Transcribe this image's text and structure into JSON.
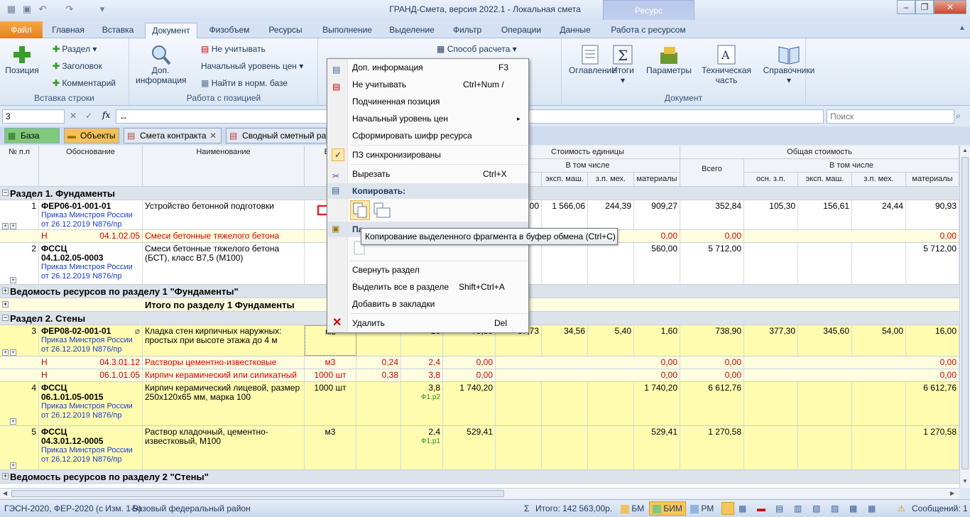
{
  "window": {
    "title": "ГРАНД-Смета, версия 2022.1 - Локальная смета",
    "context_tab": "Ресурс"
  },
  "tabs": [
    "Файл",
    "Главная",
    "Вставка",
    "Документ",
    "Физобъем",
    "Ресурсы",
    "Выполнение",
    "Выделение",
    "Фильтр",
    "Операции",
    "Данные",
    "Работа с ресурсом"
  ],
  "ribbon": {
    "insert_row": {
      "label": "Вставка строки",
      "position": "Позиция",
      "section": "Раздел",
      "heading": "Заголовок",
      "comment": "Комментарий"
    },
    "position_work": {
      "label": "Работа с позицией",
      "dop_info": "Доп. информация",
      "ignore": "Не учитывать",
      "price_level": "Начальный уровень цен",
      "find_norm": "Найти в норм. базе"
    },
    "calc_method": "Способ расчета",
    "document": {
      "label": "Документ",
      "toc": "Оглавление",
      "totals": "Итоги",
      "params": "Параметры",
      "tech": "Техническая часть",
      "refs": "Справочники"
    }
  },
  "formula": {
    "cell": "3",
    "value": "",
    "search_placeholder": "Поиск"
  },
  "doc_tabs": [
    "База",
    "Объекты",
    "Смета контракта",
    "Сводный сметный рас"
  ],
  "headers": {
    "num": "№ п.п",
    "basis": "Обоснование",
    "name": "Наименование",
    "unit": "Ед.",
    "unit_cost": "Стоимость единицы",
    "incl": "В том числе",
    "total_cost": "Общая стоимость",
    "all": "Всего",
    "incl2": "В том числе",
    "cols": [
      "осн. з.п.",
      "эксп. маш.",
      "з.п. мех.",
      "материалы"
    ]
  },
  "rows": [
    {
      "type": "section",
      "text": "Раздел 1. Фундаменты"
    },
    {
      "type": "item",
      "num": "1",
      "code": "ФЕР06-01-001-01",
      "order": "Приказ Минстроя России от 26.12.2019 N876/пр",
      "name": "Устройство бетонной подготовки",
      "unit": "",
      "c1": "",
      "c2": "",
      "c3": "",
      "c4": ",00",
      "c5": "1 566,06",
      "c6": "244,39",
      "c7": "909,27",
      "t1": "352,84",
      "t2": "105,30",
      "t3": "156,61",
      "t4": "24,44",
      "t5": "90,93"
    },
    {
      "type": "res",
      "mark": "Н",
      "code": "04.1.02.05",
      "name": "Смеси бетонные тяжелого бетона",
      "unit": "",
      "a": "",
      "b": "",
      "c": "",
      "m": "0,00",
      "t": "0,00",
      "tm": "0,00"
    },
    {
      "type": "item2",
      "num": "2",
      "code1": "ФССЦ",
      "code2": "04.1.02.05-0003",
      "order": "Приказ Минстроя России от 26.12.2019 N876/пр",
      "name": "Смеси бетонные тяжелого бетона (БСТ), класс В7,5 (М100)",
      "c7": "560,00",
      "t1": "5 712,00",
      "t5": "5 712,00"
    },
    {
      "type": "section",
      "text": "Ведомость ресурсов по разделу 1 \"Фундаменты\""
    },
    {
      "type": "total",
      "text": "Итого по разделу 1 Фундаменты"
    },
    {
      "type": "section",
      "text": "Раздел 2. Стены"
    },
    {
      "type": "item",
      "num": "3",
      "code": "ФЕР08-02-001-01",
      "order": "Приказ Минстроя России от 26.12.2019 N876/пр",
      "name": "Кладка стен кирпичных наружных: простых при высоте этажа до 4 м",
      "unit": "м3",
      "c1": "",
      "c2": "16",
      "c3": "75,89",
      "c4": "37,73",
      "c5": "34,56",
      "c6": "5,40",
      "c7": "1,60",
      "t1": "738,90",
      "t2": "377,30",
      "t3": "345,60",
      "t4": "54,00",
      "t5": "16,00"
    },
    {
      "type": "res",
      "mark": "Н",
      "code": "04.3.01.12",
      "name": "Растворы цементно-известковые",
      "unit": "м3",
      "a": "0,24",
      "b": "2,4",
      "c": "0,00",
      "m": "0,00",
      "t": "0,00",
      "tm": "0,00"
    },
    {
      "type": "res",
      "mark": "Н",
      "code": "06.1.01.05",
      "name": "Кирпич керамический или силикатный",
      "unit": "1000 шт",
      "a": "0,38",
      "b": "3,8",
      "c": "0,00",
      "m": "0,00",
      "t": "0,00",
      "tm": "0,00"
    },
    {
      "type": "item2",
      "num": "4",
      "code1": "ФССЦ",
      "code2": "06.1.01.05-0015",
      "order": "Приказ Минстроя России от 26.12.2019 N876/пр",
      "name": "Кирпич керамический лицевой, размер 250х120х65 мм, марка 100",
      "unit": "1000 шт",
      "qty": "3,8",
      "qref": "Ф1.р2",
      "c3": "1 740,20",
      "c7": "1 740,20",
      "t1": "6 612,76",
      "t5": "6 612,76"
    },
    {
      "type": "item2",
      "num": "5",
      "code1": "ФССЦ",
      "code2": "04.3.01.12-0005",
      "order": "Приказ Минстроя России от 26.12.2019 N876/пр",
      "name": "Раствор кладочный, цементно-известковый, М100",
      "unit": "м3",
      "qty": "2,4",
      "qref": "Ф1.р1",
      "c3": "529,41",
      "c7": "529,41",
      "t1": "1 270,58",
      "t5": "1 270,58"
    },
    {
      "type": "section",
      "text": "Ведомость ресурсов по разделу 2 \"Стены\""
    }
  ],
  "menu": {
    "items": [
      {
        "label": "Доп. информация",
        "shortcut": "F3"
      },
      {
        "label": "Не учитывать",
        "shortcut": "Ctrl+Num /"
      },
      {
        "label": "Подчиненная позиция",
        "shortcut": ""
      },
      {
        "label": "Начальный уровень цен",
        "shortcut": "▸"
      },
      {
        "label": "Сформировать шифр ресурса",
        "shortcut": ""
      },
      {
        "label": "ПЗ синхронизированы",
        "shortcut": ""
      },
      {
        "label": "Вырезать",
        "shortcut": "Ctrl+X"
      },
      {
        "label": "Копировать:",
        "shortcut": ""
      },
      {
        "label": "Па",
        "shortcut": ""
      },
      {
        "label": "Свернуть раздел",
        "shortcut": ""
      },
      {
        "label": "Выделить все в разделе",
        "shortcut": "Shift+Ctrl+A"
      },
      {
        "label": "Добавить в закладки",
        "shortcut": ""
      },
      {
        "label": "Удалить",
        "shortcut": "Del"
      }
    ],
    "tooltip": "Копирование выделенного фрагмента в буфер обмена (Ctrl+C)"
  },
  "status": {
    "norms": "ГЭСН-2020, ФЕР-2020 (с Изм. 1-9)",
    "region": "Базовый федеральный район",
    "total": "Итого: 142 563,00р.",
    "bm": "БМ",
    "bim": "БИМ",
    "rm": "РМ",
    "messages": "Сообщений: 1"
  }
}
